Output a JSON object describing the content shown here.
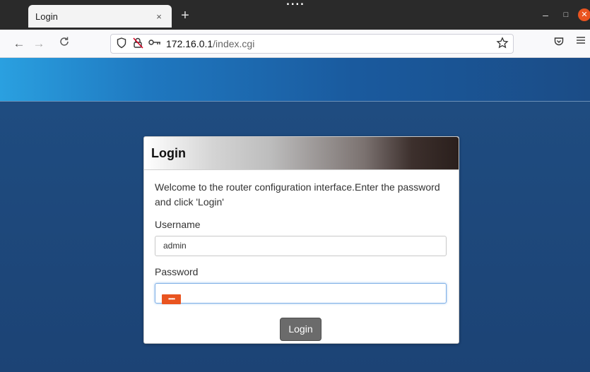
{
  "top_strip": {
    "cropped_text": "...."
  },
  "browser": {
    "tab": {
      "title": "Login",
      "close_glyph": "×"
    },
    "new_tab_glyph": "+",
    "window_controls": {
      "minimize": "–",
      "maximize": "□",
      "close": "✕"
    },
    "nav": {
      "back": "←",
      "forward": "→",
      "reload": "C"
    },
    "url": {
      "host": "172.16.0.1",
      "path": "/index.cgi"
    },
    "icons": {
      "shield": "shield-icon",
      "lock_warning": "lock-warning-icon",
      "key": "key-icon",
      "star": "star-icon",
      "pocket": "pocket-icon",
      "menu": "hamburger-menu-icon"
    }
  },
  "login": {
    "title": "Login",
    "welcome": "Welcome to the router configuration interface.Enter the password and click 'Login'",
    "username_label": "Username",
    "username_value": "admin",
    "password_label": "Password",
    "password_mask": "•••••",
    "button_label": "Login"
  },
  "colors": {
    "header_start": "#2aa0e0",
    "page_bg": "#1e4b7e",
    "accent_orange": "#e95420",
    "button_bg": "#6b6b6b"
  }
}
